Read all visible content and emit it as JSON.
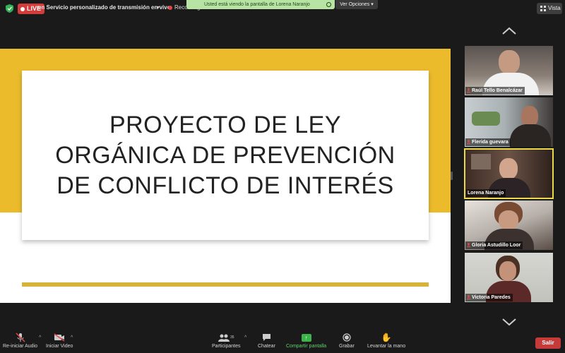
{
  "top_bar": {
    "live_label": "LIVE",
    "stream_label": "en Servicio personalizado de transmisión en vivo",
    "recording_label": "Recording",
    "share_banner": "Usted está viendo la pantalla de Lorena Naranjo",
    "options_label": "Ver Opciones",
    "view_label": "Vista"
  },
  "slide": {
    "title_line1": "PROYECTO DE LEY",
    "title_line2": "ORGÁNICA DE PREVENCIÓN",
    "title_line3": "DE CONFLICTO DE INTERÉS",
    "gold_color": "#ECBB2B",
    "line_color": "#D6B43C"
  },
  "participants": [
    {
      "name": "Raúl Tello Benalcázar",
      "muted": true,
      "active": false
    },
    {
      "name": "Flerida guevara",
      "muted": true,
      "active": false
    },
    {
      "name": "Lorena Naranjo",
      "muted": false,
      "active": true
    },
    {
      "name": "Gloria Astudillo Loor",
      "muted": true,
      "active": false
    },
    {
      "name": "Victoria Paredes",
      "muted": true,
      "active": false
    }
  ],
  "toolbar": {
    "audio_label": "Re-iniciar Audio",
    "video_label": "Iniciar Video",
    "participants_label": "Participantes",
    "participants_count": "35",
    "chat_label": "Chatear",
    "share_label": "Compartir pantalla",
    "record_label": "Grabar",
    "raise_hand_label": "Levantar la mano",
    "leave_label": "Salir"
  }
}
